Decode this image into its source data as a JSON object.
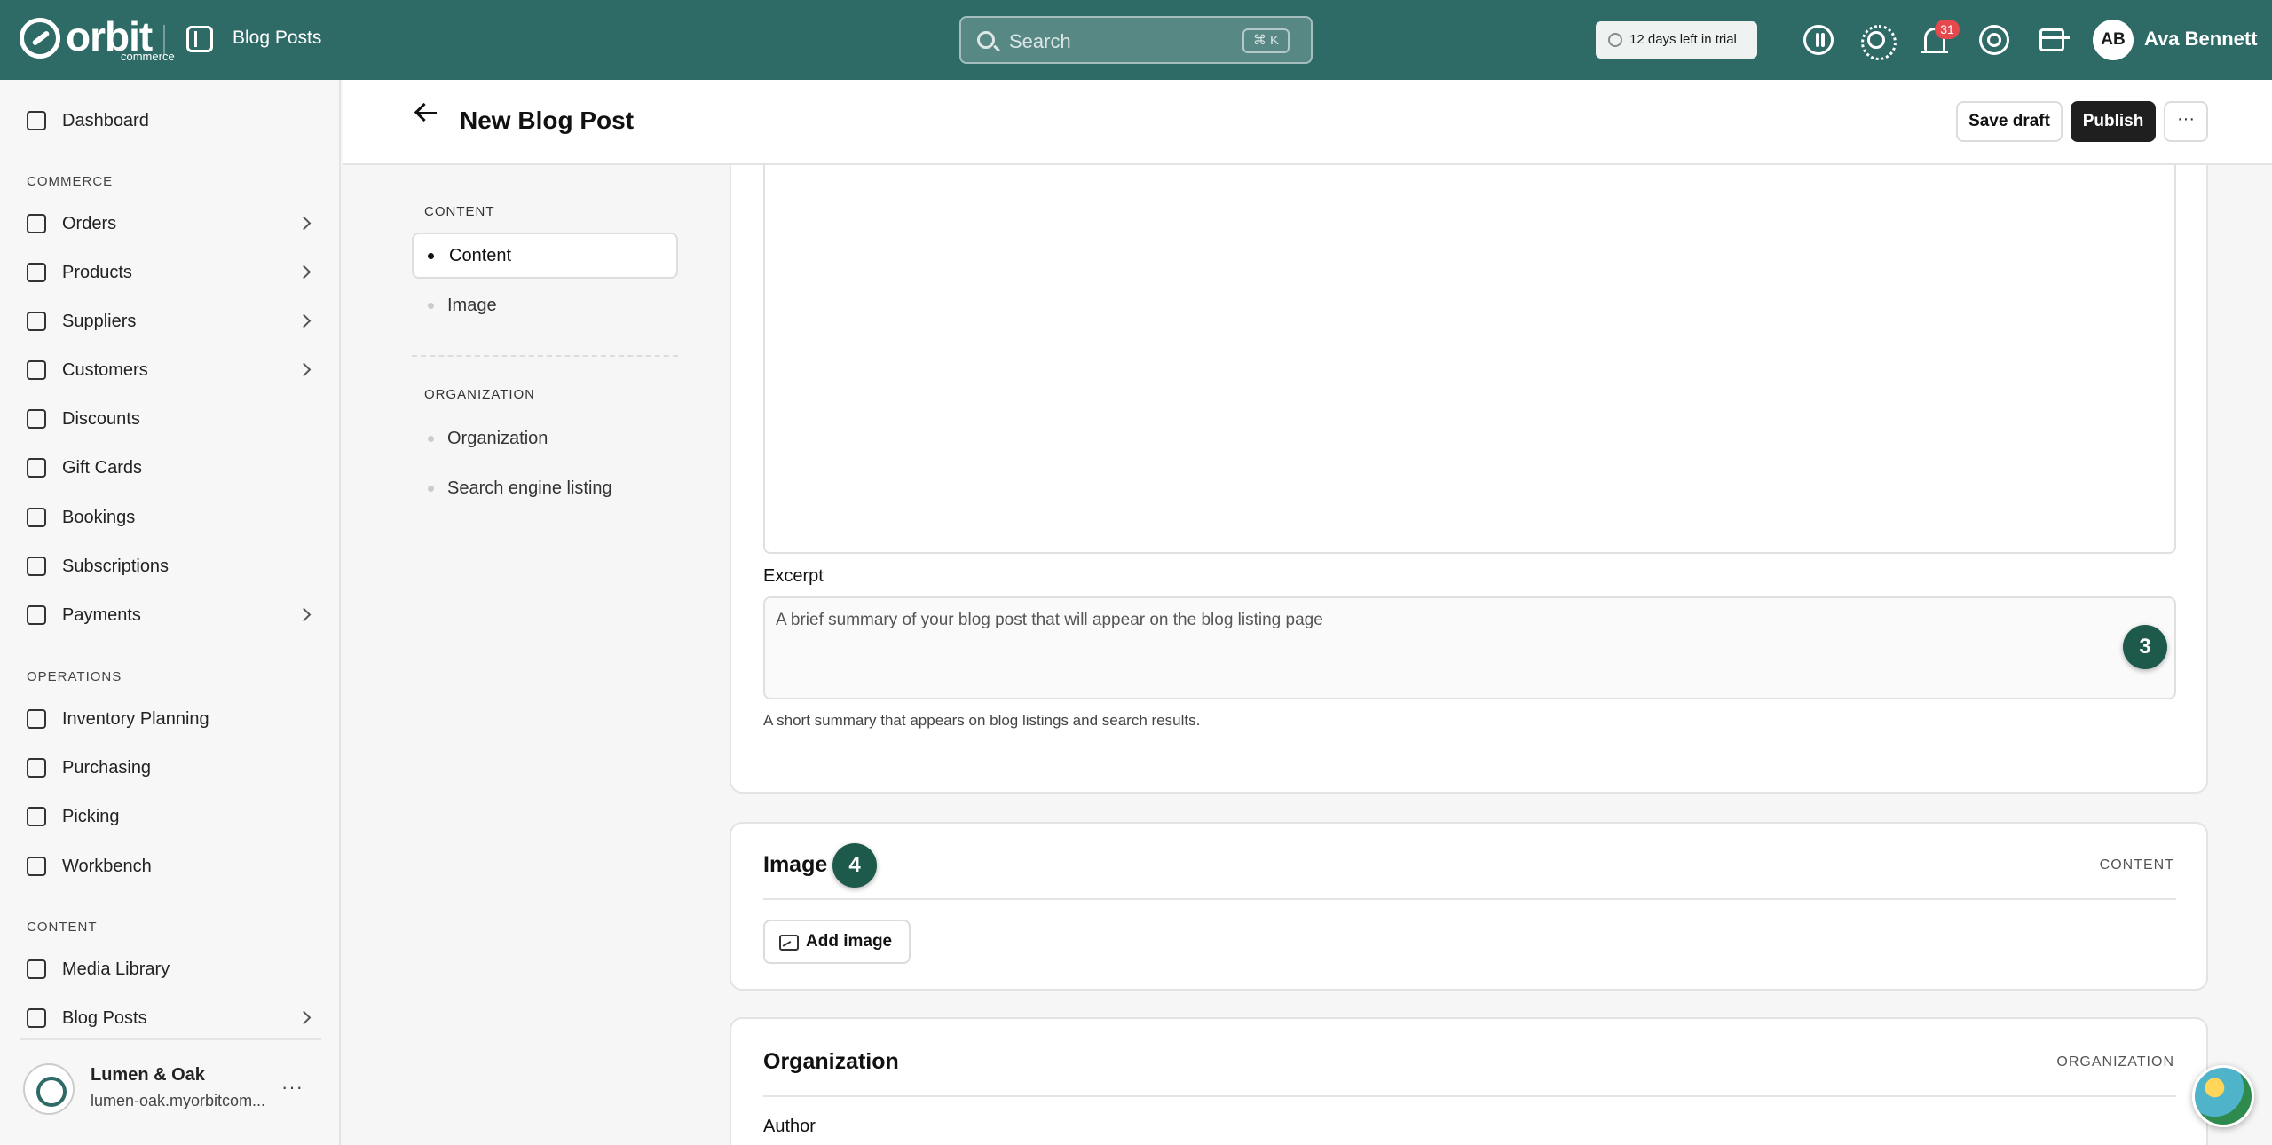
{
  "topbar": {
    "logo_word": "orbit",
    "logo_sub": "commerce",
    "breadcrumb": "Blog Posts",
    "search_placeholder": "Search",
    "search_shortcut": "⌘ K",
    "trial_text": "12 days left in trial",
    "notifications_count": "31",
    "avatar_initials": "AB",
    "user_name": "Ava Bennett"
  },
  "sidebar": {
    "top_item": "Dashboard",
    "sections": [
      {
        "title": "COMMERCE",
        "items": [
          {
            "label": "Orders",
            "chevron": true
          },
          {
            "label": "Products",
            "chevron": true
          },
          {
            "label": "Suppliers",
            "chevron": true
          },
          {
            "label": "Customers",
            "chevron": true
          },
          {
            "label": "Discounts",
            "chevron": false
          },
          {
            "label": "Gift Cards",
            "chevron": false
          },
          {
            "label": "Bookings",
            "chevron": false
          },
          {
            "label": "Subscriptions",
            "chevron": false
          },
          {
            "label": "Payments",
            "chevron": true
          }
        ]
      },
      {
        "title": "OPERATIONS",
        "items": [
          {
            "label": "Inventory Planning",
            "chevron": false
          },
          {
            "label": "Purchasing",
            "chevron": false
          },
          {
            "label": "Picking",
            "chevron": false
          },
          {
            "label": "Workbench",
            "chevron": false
          }
        ]
      },
      {
        "title": "CONTENT",
        "items": [
          {
            "label": "Media Library",
            "chevron": false
          },
          {
            "label": "Blog Posts",
            "chevron": true
          }
        ]
      }
    ],
    "store": {
      "name": "Lumen & Oak",
      "url": "lumen-oak.myorbitcom...",
      "more": "···"
    }
  },
  "page": {
    "title": "New Blog Post",
    "save_draft": "Save draft",
    "publish": "Publish",
    "more": "···"
  },
  "section_nav": {
    "groups": [
      {
        "title": "CONTENT",
        "items": [
          {
            "label": "Content",
            "active": true
          },
          {
            "label": "Image",
            "active": false
          }
        ]
      },
      {
        "title": "ORGANIZATION",
        "items": [
          {
            "label": "Organization",
            "active": false
          },
          {
            "label": "Search engine listing",
            "active": false
          }
        ]
      }
    ]
  },
  "content_card": {
    "excerpt_label": "Excerpt",
    "excerpt_placeholder": "A brief summary of your blog post that will appear on the blog listing page",
    "excerpt_helper": "A short summary that appears on blog listings and search results.",
    "step_badge": "3"
  },
  "image_card": {
    "title": "Image",
    "tag": "CONTENT",
    "step_badge": "4",
    "add_image": "Add image"
  },
  "organization_card": {
    "title": "Organization",
    "tag": "ORGANIZATION",
    "author_label": "Author"
  }
}
